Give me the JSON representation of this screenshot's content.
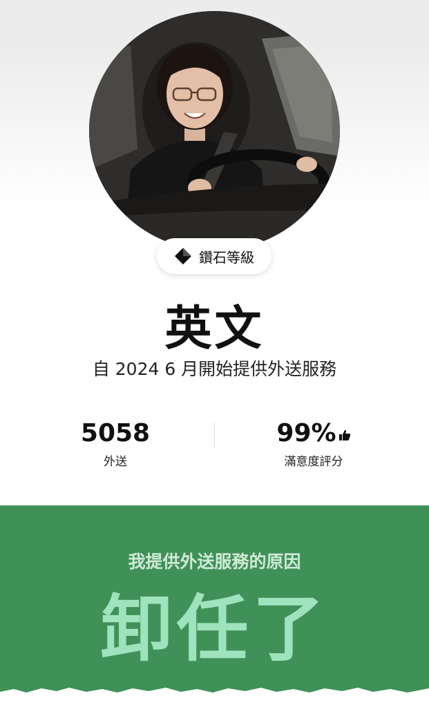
{
  "profile": {
    "tier_label": "鑽石等級",
    "name": "英文",
    "since": "自 2024 6 月開始提供外送服務"
  },
  "stats": {
    "deliveries": {
      "value": "5058",
      "label": "外送"
    },
    "rating": {
      "value": "99%",
      "label": "滿意度評分",
      "icon": "thumbs-up-icon"
    }
  },
  "reason": {
    "title": "我提供外送服務的原因",
    "text": "卸任了"
  },
  "colors": {
    "reason_bg": "#3f9158",
    "reason_text": "#9ee3bd",
    "reason_subtitle": "#cfe9d6"
  }
}
